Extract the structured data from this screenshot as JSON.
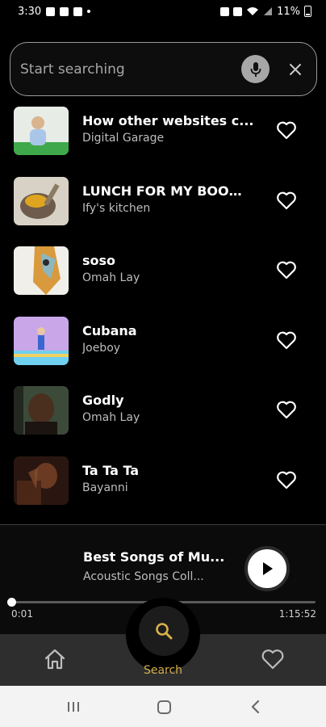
{
  "status_bar": {
    "time": "3:30",
    "battery": "11%"
  },
  "search": {
    "placeholder": "Start searching",
    "icons": {
      "mic": "mic-icon",
      "clear": "close-icon"
    }
  },
  "results": [
    {
      "title": "How other websites c...",
      "artist": "Digital Garage",
      "thumb_colors": [
        "#e7ece6",
        "#3fa84a"
      ]
    },
    {
      "title": "LUNCH FOR MY BOO🥰...",
      "artist": "Ify's kitchen",
      "thumb_colors": [
        "#6e5b4b",
        "#e0a520"
      ]
    },
    {
      "title": "soso",
      "artist": "Omah Lay",
      "thumb_colors": [
        "#f1efe9",
        "#d89a3c"
      ]
    },
    {
      "title": "Cubana",
      "artist": "Joeboy",
      "thumb_colors": [
        "#c8a6e8",
        "#6fd0f0"
      ]
    },
    {
      "title": "Godly",
      "artist": "Omah Lay",
      "thumb_colors": [
        "#3c4a3a",
        "#1b1410"
      ]
    },
    {
      "title": "Ta Ta Ta",
      "artist": "Bayanni",
      "thumb_colors": [
        "#6b3a22",
        "#2a1610"
      ]
    }
  ],
  "now_playing": {
    "title": "Best Songs of Mu...",
    "artist": "Acoustic Songs Coll...",
    "current_time": "0:01",
    "total_time": "1:15:52",
    "progress": 0.0002
  },
  "bottom_nav": {
    "home_icon": "home-icon",
    "search_label": "Search",
    "favorites_icon": "heart-icon"
  },
  "colors": {
    "accent": "#d8b04a",
    "background": "#000000",
    "nav_background": "#2e2e2e"
  }
}
